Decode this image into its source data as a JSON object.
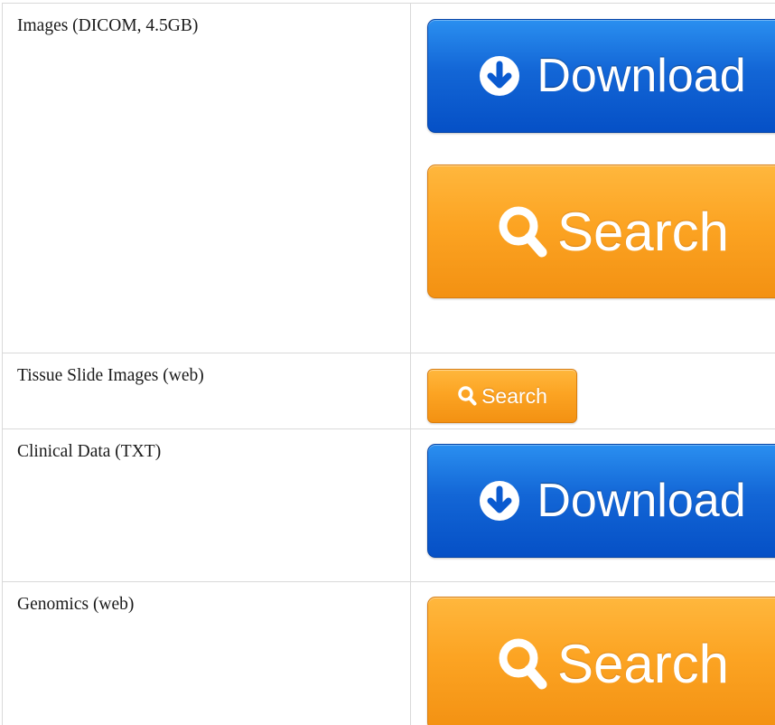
{
  "table": {
    "rows": [
      {
        "label": "Images (DICOM, 4.5GB)"
      },
      {
        "label": "Tissue Slide Images (web)"
      },
      {
        "label": "Clinical Data (TXT)"
      },
      {
        "label": "Genomics (web)"
      }
    ]
  },
  "buttons": {
    "download_label": "Download",
    "search_label": "Search"
  },
  "icons": {
    "download": "download-circle-arrow-icon",
    "search": "magnifier-icon"
  },
  "colors": {
    "download_top": "#2a8ff0",
    "download_bottom": "#0550c6",
    "search_top": "#ffb73d",
    "search_bottom": "#f39112",
    "border": "#d9d9d9",
    "text": "#1a1a1a"
  }
}
